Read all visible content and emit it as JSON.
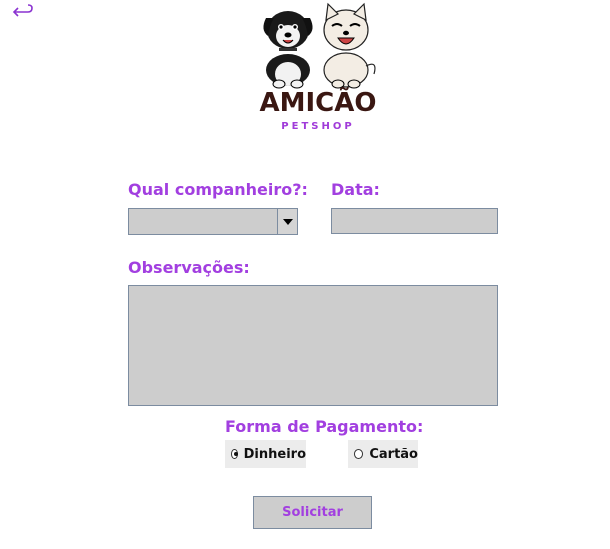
{
  "header": {
    "back_icon": "return-arrow-icon",
    "logo_icon": "two-dogs-logo-icon",
    "brand_name": "AMICÃO",
    "brand_tagline": "PETSHOP"
  },
  "form": {
    "companion_label": "Qual companheiro?:",
    "companion_value": "",
    "date_label": "Data:",
    "date_value": "",
    "notes_label": "Observações:",
    "notes_value": "",
    "payment_label": "Forma de Pagamento:",
    "payment_options": [
      {
        "label": "Dinheiro",
        "selected": true
      },
      {
        "label": "Cartão",
        "selected": false
      }
    ],
    "submit_label": "Solicitar"
  },
  "colors": {
    "accent": "#a23fe0",
    "field_bg": "#cdcdcd",
    "brand_text": "#3a1712"
  }
}
